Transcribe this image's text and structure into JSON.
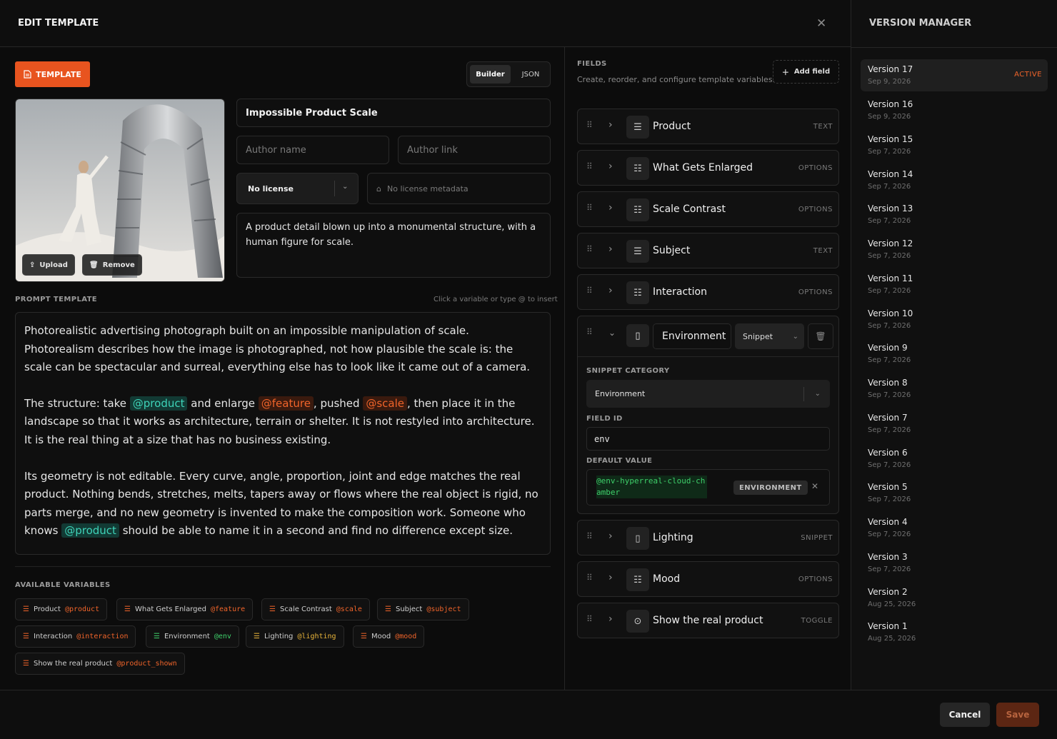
{
  "header": {
    "title": "EDIT TEMPLATE"
  },
  "version_manager": {
    "title": "VERSION MANAGER",
    "active_badge": "ACTIVE",
    "versions": [
      {
        "name": "Version 17",
        "date": "Sep 9, 2026"
      },
      {
        "name": "Version 16",
        "date": "Sep 9, 2026"
      },
      {
        "name": "Version 15",
        "date": "Sep 7, 2026"
      },
      {
        "name": "Version 14",
        "date": "Sep 7, 2026"
      },
      {
        "name": "Version 13",
        "date": "Sep 7, 2026"
      },
      {
        "name": "Version 12",
        "date": "Sep 7, 2026"
      },
      {
        "name": "Version 11",
        "date": "Sep 7, 2026"
      },
      {
        "name": "Version 10",
        "date": "Sep 7, 2026"
      },
      {
        "name": "Version 9",
        "date": "Sep 7, 2026"
      },
      {
        "name": "Version 8",
        "date": "Sep 7, 2026"
      },
      {
        "name": "Version 7",
        "date": "Sep 7, 2026"
      },
      {
        "name": "Version 6",
        "date": "Sep 7, 2026"
      },
      {
        "name": "Version 5",
        "date": "Sep 7, 2026"
      },
      {
        "name": "Version 4",
        "date": "Sep 7, 2026"
      },
      {
        "name": "Version 3",
        "date": "Sep 7, 2026"
      },
      {
        "name": "Version 2",
        "date": "Aug 25, 2026"
      },
      {
        "name": "Version 1",
        "date": "Aug 25, 2026"
      }
    ]
  },
  "builder": {
    "template_button": "TEMPLATE",
    "mode_builder": "Builder",
    "mode_json": "JSON",
    "upload": "Upload",
    "remove": "Remove",
    "title_value": "Impossible Product Scale",
    "author_name_placeholder": "Author name",
    "author_link_placeholder": "Author link",
    "license": "No license",
    "license_meta_placeholder": "No license metadata",
    "description": "A product detail blown up into a monumental structure, with a human figure for scale.",
    "prompt_label": "PROMPT TEMPLATE",
    "prompt_hint": "Click a variable or type @ to insert",
    "p1": "Photorealistic advertising photograph built on an impossible manipulation of scale. Photorealism describes how the image is photographed, not how plausible the scale is: the scale can be spectacular and surreal, everything else has to look like it came out of a camera.",
    "p2a": "The structure: take ",
    "v_product": "@product",
    "p2b": " and enlarge ",
    "v_feature": "@feature",
    "p2c": ", pushed ",
    "v_scale": "@scale",
    "p2d": ", then place it in the landscape so that it works as architecture, terrain or shelter. It is not restyled into architecture. It is the real thing at a size that has no business existing.",
    "p3a": "Its geometry is not editable. Every curve, angle, proportion, joint and edge matches the real product. Nothing bends, stretches, melts, tapers away or flows where the real object is rigid, no parts merge, and no new geometry is invented to make the composition work. Someone who knows ",
    "p3b": "should be able to name it in a second and find no difference except size.",
    "vars_label": "AVAILABLE VARIABLES",
    "vars": [
      {
        "name": "Product",
        "tag": "@product",
        "color": "#f0642a"
      },
      {
        "name": "What Gets Enlarged",
        "tag": "@feature",
        "color": "#f0642a"
      },
      {
        "name": "Scale Contrast",
        "tag": "@scale",
        "color": "#f0642a"
      },
      {
        "name": "Subject",
        "tag": "@subject",
        "color": "#f0642a"
      },
      {
        "name": "Interaction",
        "tag": "@interaction",
        "color": "#f0642a"
      },
      {
        "name": "Environment",
        "tag": "@env",
        "color": "#3ecf6a"
      },
      {
        "name": "Lighting",
        "tag": "@lighting",
        "color": "#e8b43a"
      },
      {
        "name": "Mood",
        "tag": "@mood",
        "color": "#f0642a"
      },
      {
        "name": "Show the real product",
        "tag": "@product_shown",
        "color": "#f0642a"
      }
    ]
  },
  "fields": {
    "title": "FIELDS",
    "subtitle": "Create, reorder, and configure template variables.",
    "add": "Add field",
    "items": [
      {
        "name": "Product",
        "type": "TEXT"
      },
      {
        "name": "What Gets Enlarged",
        "type": "OPTIONS"
      },
      {
        "name": "Scale Contrast",
        "type": "OPTIONS"
      },
      {
        "name": "Subject",
        "type": "TEXT"
      },
      {
        "name": "Interaction",
        "type": "OPTIONS"
      },
      {
        "name": "Lighting",
        "type": "SNIPPET"
      },
      {
        "name": "Mood",
        "type": "OPTIONS"
      },
      {
        "name": "Show the real product",
        "type": "TOGGLE"
      }
    ],
    "expanded": {
      "name": "Environment",
      "type_select": "Snippet",
      "cat_label": "SNIPPET CATEGORY",
      "cat_value": "Environment",
      "id_label": "FIELD ID",
      "id_value": "env",
      "def_label": "DEFAULT VALUE",
      "def_value": "@env-hyperreal-cloud-chamber",
      "def_badge": "ENVIRONMENT"
    }
  },
  "footer": {
    "cancel": "Cancel",
    "save": "Save"
  }
}
